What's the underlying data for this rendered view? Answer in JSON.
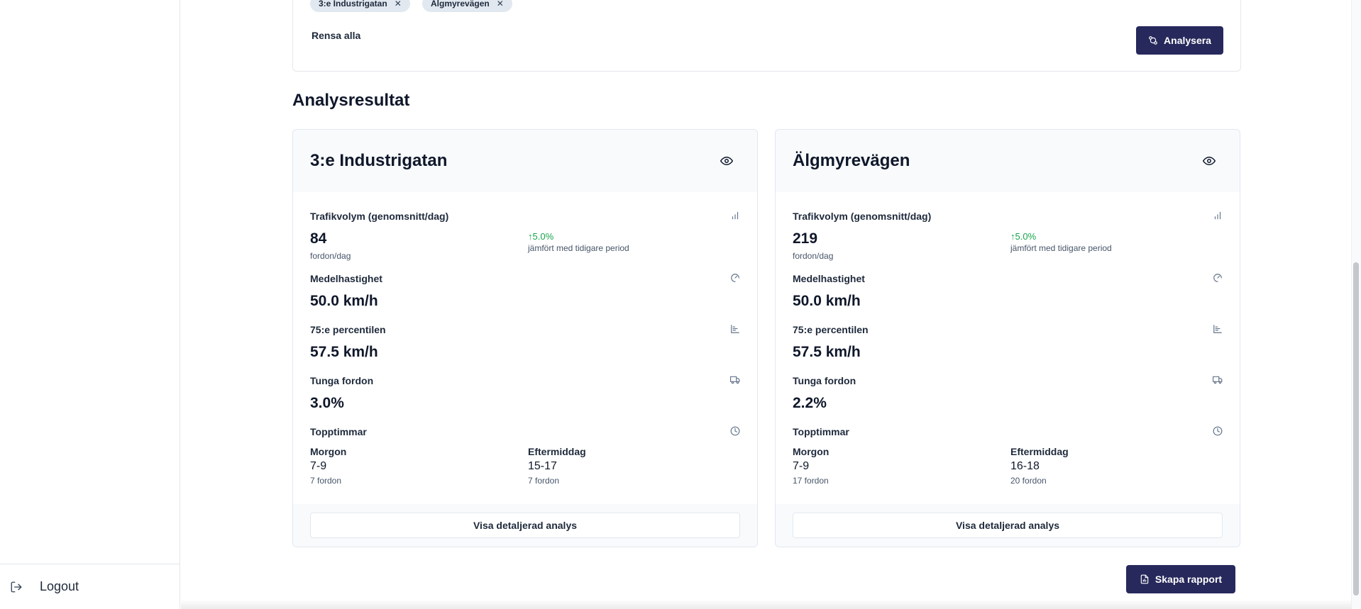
{
  "sidebar": {
    "logout_label": "Logout"
  },
  "filters": {
    "chips": [
      "3:e Industrigatan",
      "Älgmyrevägen"
    ],
    "clear_label": "Rensa alla",
    "analyze_label": "Analysera"
  },
  "results": {
    "title": "Analysresultat",
    "cards": [
      {
        "title": "3:e Industrigatan",
        "traffic_label": "Trafikvolym (genomsnitt/dag)",
        "traffic_value": "84",
        "traffic_unit": "fordon/dag",
        "change": "5.0%",
        "change_note": "jämfört med tidigare period",
        "avg_speed_label": "Medelhastighet",
        "avg_speed_value": "50.0 km/h",
        "p75_label": "75:e percentilen",
        "p75_value": "57.5 km/h",
        "heavy_label": "Tunga fordon",
        "heavy_value": "3.0%",
        "peak_label": "Topptimmar",
        "morning_label": "Morgon",
        "morning_hours": "7-9",
        "morning_count": "7 fordon",
        "afternoon_label": "Eftermiddag",
        "afternoon_hours": "15-17",
        "afternoon_count": "7 fordon",
        "detail_label": "Visa detaljerad analys"
      },
      {
        "title": "Älgmyrevägen",
        "traffic_label": "Trafikvolym (genomsnitt/dag)",
        "traffic_value": "219",
        "traffic_unit": "fordon/dag",
        "change": "5.0%",
        "change_note": "jämfört med tidigare period",
        "avg_speed_label": "Medelhastighet",
        "avg_speed_value": "50.0 km/h",
        "p75_label": "75:e percentilen",
        "p75_value": "57.5 km/h",
        "heavy_label": "Tunga fordon",
        "heavy_value": "2.2%",
        "peak_label": "Topptimmar",
        "morning_label": "Morgon",
        "morning_hours": "7-9",
        "morning_count": "17 fordon",
        "afternoon_label": "Eftermiddag",
        "afternoon_hours": "16-18",
        "afternoon_count": "20 fordon",
        "detail_label": "Visa detaljerad analys"
      }
    ]
  },
  "report_label": "Skapa rapport",
  "colors": {
    "primary": "#27295c",
    "positive": "#16a34a",
    "card_header": "#f8fafc"
  },
  "icons": [
    "logout-icon",
    "close-icon",
    "compare-icon",
    "eye-icon",
    "bar-chart-icon",
    "gauge-icon",
    "percentile-chart-icon",
    "truck-icon",
    "clock-icon",
    "file-report-icon",
    "arrow-up-icon"
  ]
}
